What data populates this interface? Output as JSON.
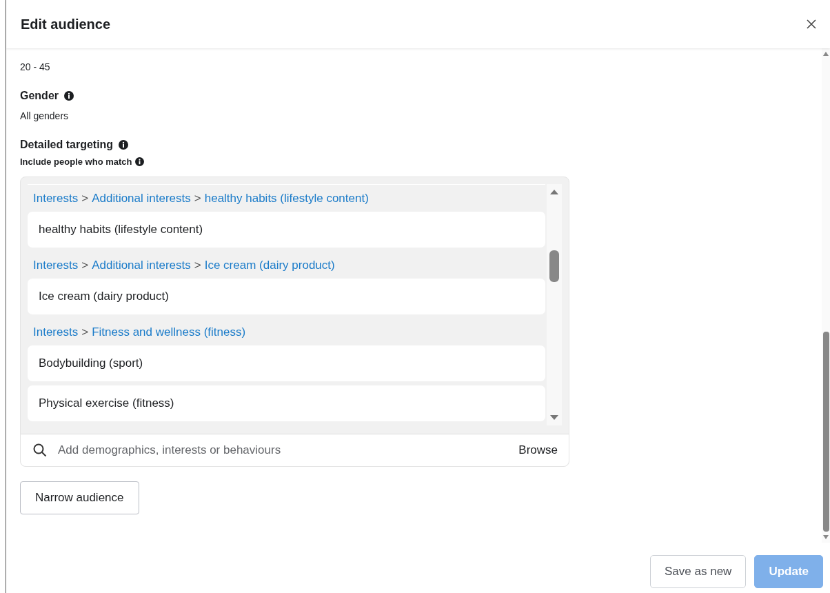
{
  "dialog": {
    "title": "Edit audience"
  },
  "fields": [
    {
      "value": "20 - 45"
    },
    {
      "label": "Gender",
      "value": "All genders"
    }
  ],
  "detailed_targeting": {
    "label": "Detailed targeting",
    "sublabel": "Include people who match",
    "groups": [
      {
        "path": [
          "Interests",
          ">",
          "Additional interests",
          ">",
          "healthy habits (lifestyle content)"
        ],
        "items": [
          "healthy habits (lifestyle content)"
        ]
      },
      {
        "path": [
          "Interests",
          ">",
          "Additional interests",
          ">",
          "Ice cream (dairy product)"
        ],
        "items": [
          "Ice cream (dairy product)"
        ]
      },
      {
        "path": [
          "Interests",
          ">",
          "Fitness and wellness (fitness)"
        ],
        "items": [
          "Bodybuilding (sport)",
          "Physical exercise (fitness)"
        ]
      }
    ],
    "search": {
      "placeholder": "Add demographics, interests or behaviours",
      "browse": "Browse"
    }
  },
  "narrow_button": "Narrow audience",
  "footer": [
    {
      "label": "Save as new",
      "kind": "secondary",
      "disabled": false
    },
    {
      "label": "Update",
      "kind": "primary",
      "disabled": true
    }
  ]
}
